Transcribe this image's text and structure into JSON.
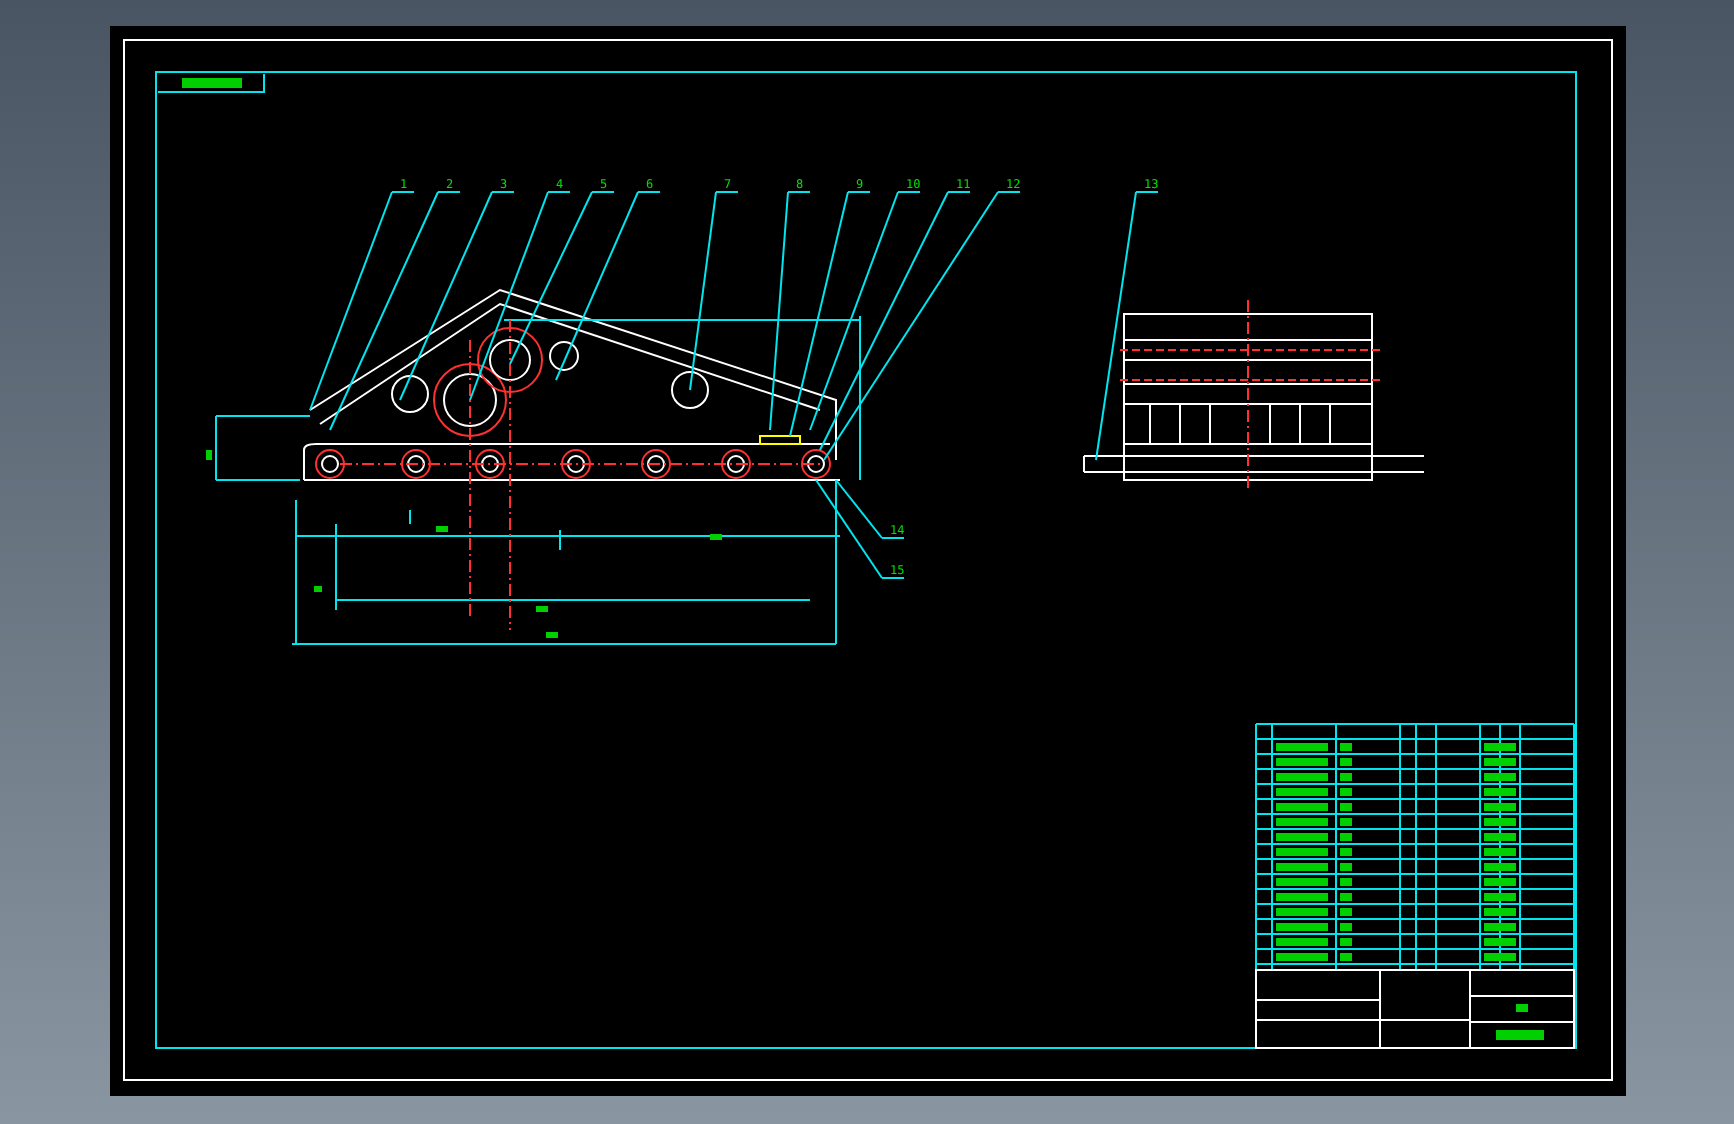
{
  "balloons": [
    {
      "label": "1"
    },
    {
      "label": "2"
    },
    {
      "label": "3"
    },
    {
      "label": "4"
    },
    {
      "label": "5"
    },
    {
      "label": "6"
    },
    {
      "label": "7"
    },
    {
      "label": "8"
    },
    {
      "label": "9"
    },
    {
      "label": "10"
    },
    {
      "label": "11"
    },
    {
      "label": "12"
    },
    {
      "label": "13"
    },
    {
      "label": "14"
    },
    {
      "label": "15"
    }
  ]
}
